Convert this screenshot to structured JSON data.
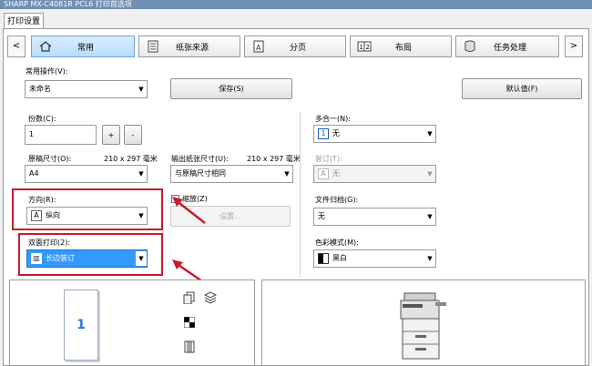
{
  "window": {
    "title": "SHARP MX-C4081R PCL6 打印首选项"
  },
  "tab_top": {
    "label": "打印设置"
  },
  "tabs": [
    {
      "label": "常用",
      "icon": "home-icon"
    },
    {
      "label": "纸张来源",
      "icon": "paper-tray-icon"
    },
    {
      "label": "分页",
      "icon": "page-icon"
    },
    {
      "label": "布局",
      "icon": "layout-icon"
    },
    {
      "label": "任务处理",
      "icon": "job-icon"
    }
  ],
  "nav": {
    "prev": "<",
    "next": ">"
  },
  "quick": {
    "label": "常用操作(V):",
    "value": "未命名",
    "save": "保存(S)",
    "defaults": "默认值(F)"
  },
  "copies": {
    "label": "份数(C):",
    "value": "1",
    "plus": "+",
    "minus": "-"
  },
  "original_size": {
    "label": "原稿尺寸(O):",
    "value": "A4",
    "dims": "210 x 297 毫米"
  },
  "output_size": {
    "label": "输出纸张尺寸(U):",
    "value": "与原稿尺寸相同",
    "dims": "210 x 297 毫米"
  },
  "orientation": {
    "label": "方向(R):",
    "value": "纵向"
  },
  "scale": {
    "label": "缩放(Z)",
    "button": "设置..."
  },
  "duplex": {
    "label": "双面打印(2):",
    "value": "长边装订"
  },
  "nup": {
    "label": "多合一(N):",
    "value": "无",
    "icon_text": "1"
  },
  "staple": {
    "label": "装订(T):",
    "value": "无",
    "icon_text": "A"
  },
  "filing": {
    "label": "文件归档(G):",
    "value": "无"
  },
  "color_mode": {
    "label": "色彩模式(M):",
    "value": "黑白"
  },
  "preview": {
    "page_number": "1"
  }
}
